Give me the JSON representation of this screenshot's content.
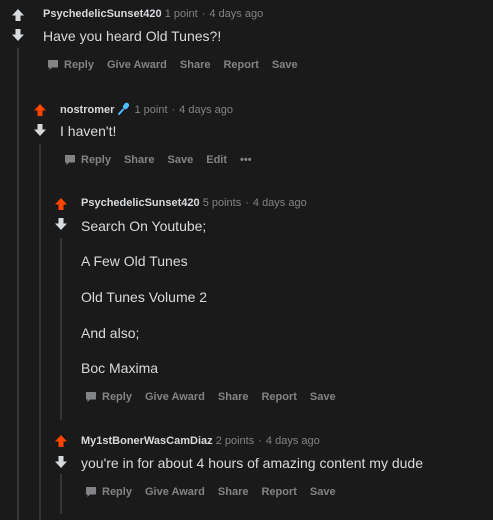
{
  "colors": {
    "background": "#1a1a1b",
    "upvote_active": "#ff4500",
    "vote_inactive": "#d7dadc",
    "muted_text": "#818384",
    "body_text": "#d7dadc",
    "mic_icon": "#4fbcff"
  },
  "comments": [
    {
      "author": "PsychedelicSunset420",
      "points": "1 point",
      "age": "4 days ago",
      "lines": [
        "Have you heard Old Tunes?!"
      ],
      "actions": {
        "reply": "Reply",
        "give_award": "Give Award",
        "share": "Share",
        "report": "Report",
        "save": "Save"
      }
    },
    {
      "author": "nostromer",
      "flair_icon": "microphone-icon",
      "points": "1 point",
      "age": "4 days ago",
      "lines": [
        "I haven't!"
      ],
      "actions": {
        "reply": "Reply",
        "share": "Share",
        "save": "Save",
        "edit": "Edit",
        "more": "•••"
      }
    },
    {
      "author": "PsychedelicSunset420",
      "points": "5 points",
      "age": "4 days ago",
      "lines": [
        "Search On Youtube;",
        "A Few Old Tunes",
        "Old Tunes Volume 2",
        "And also;",
        "Boc Maxima"
      ],
      "actions": {
        "reply": "Reply",
        "give_award": "Give Award",
        "share": "Share",
        "report": "Report",
        "save": "Save"
      }
    },
    {
      "author": "My1stBonerWasCamDiaz",
      "points": "2 points",
      "age": "4 days ago",
      "lines": [
        "you're in for about 4 hours of amazing content my dude"
      ],
      "actions": {
        "reply": "Reply",
        "give_award": "Give Award",
        "share": "Share",
        "report": "Report",
        "save": "Save"
      }
    }
  ]
}
